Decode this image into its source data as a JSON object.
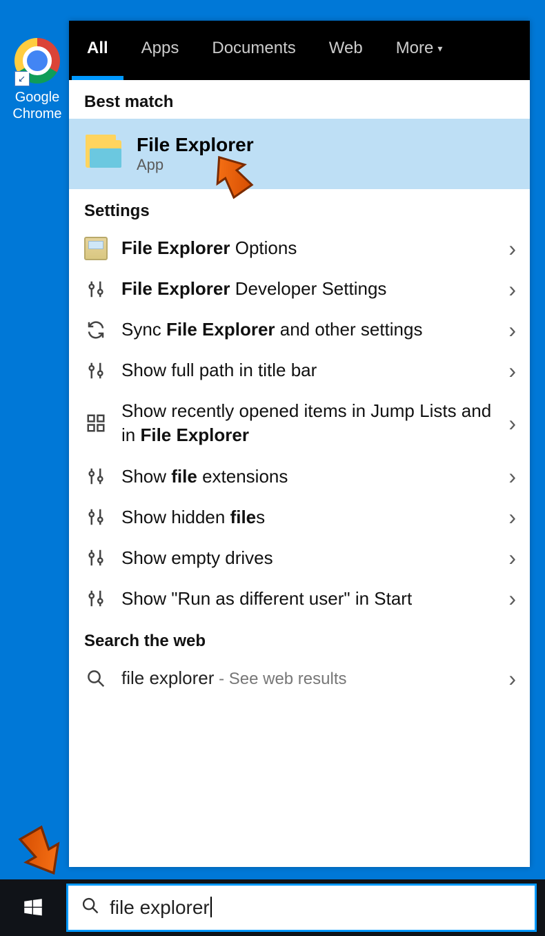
{
  "colors": {
    "desktop": "#0078d7",
    "accent": "#0099ff",
    "highlight": "#bedff5"
  },
  "desktop_icon": {
    "label": "Google Chrome"
  },
  "tabs": {
    "all": "All",
    "apps": "Apps",
    "documents": "Documents",
    "web": "Web",
    "more": "More"
  },
  "sections": {
    "best_match": "Best match",
    "settings": "Settings",
    "search_web": "Search the web"
  },
  "best_match": {
    "title": "File Explorer",
    "subtitle": "App"
  },
  "settings_items": [
    {
      "id": "options",
      "bold": "File Explorer",
      "rest": " Options",
      "icon": "options"
    },
    {
      "id": "dev",
      "bold": "File Explorer",
      "rest": " Developer Settings",
      "icon": "sliders"
    },
    {
      "id": "sync",
      "pre": "Sync ",
      "bold": "File Explorer",
      "rest": " and other settings",
      "icon": "refresh"
    },
    {
      "id": "fullpath",
      "plain": "Show full path in title bar",
      "icon": "sliders"
    },
    {
      "id": "jump",
      "pre": "Show recently opened items in Jump Lists and in ",
      "bold": "File Explorer",
      "rest": "",
      "icon": "grid"
    },
    {
      "id": "ext",
      "pre": "Show ",
      "bold": "file",
      "rest": " extensions",
      "icon": "sliders"
    },
    {
      "id": "hidden",
      "pre": "Show hidden ",
      "bold": "file",
      "rest": "s",
      "icon": "sliders"
    },
    {
      "id": "empty",
      "plain": "Show empty drives",
      "icon": "sliders"
    },
    {
      "id": "runas",
      "plain": "Show \"Run as different user\" in Start",
      "icon": "sliders"
    }
  ],
  "web_result": {
    "query": "file explorer",
    "hint": " - See web results"
  },
  "searchbox": {
    "value": "file explorer"
  },
  "icons": {
    "chevron": "›",
    "caret": "▾"
  }
}
